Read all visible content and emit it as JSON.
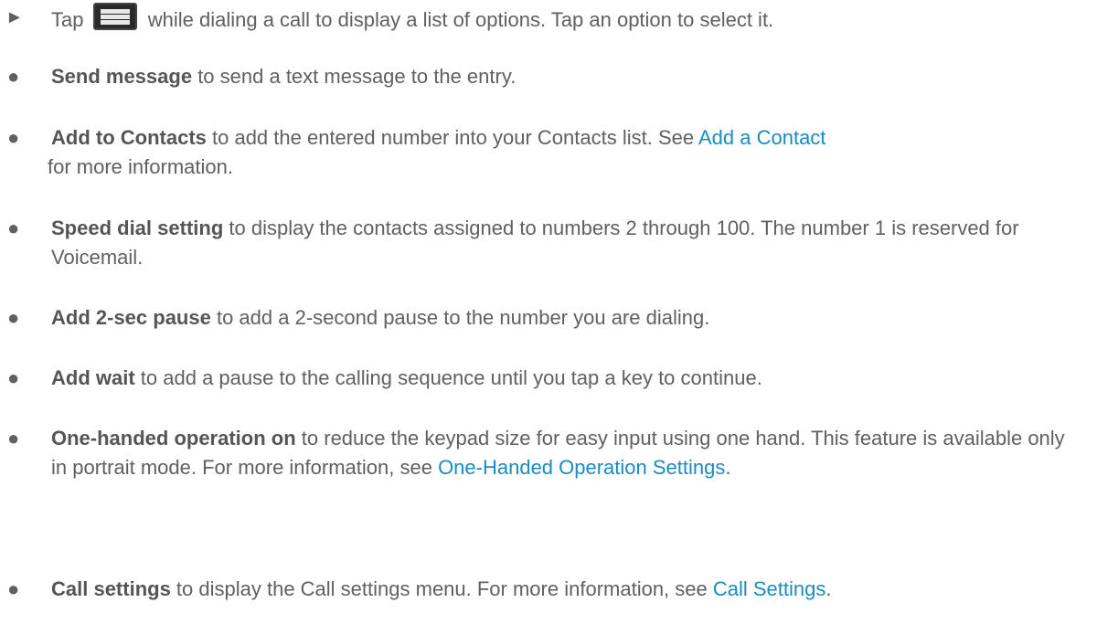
{
  "intro": {
    "bullet": "►",
    "before_icon": "Tap",
    "icon": "menu-icon",
    "after_icon": "while dialing a call to display a list of options. Tap an option to select it."
  },
  "options": [
    {
      "bullet": "●",
      "term": "Send message",
      "text": " to send a text message to the entry."
    },
    {
      "bullet": "●",
      "term": "Add to Contacts",
      "text": " to add the entered number into your Contacts list. See ",
      "link": "Add a Contact",
      "text_after": " for more information."
    },
    {
      "bullet": "●",
      "term": "Speed dial setting",
      "text": " to display the contacts assigned to numbers 2 through 100. The number 1 is reserved for Voicemail."
    },
    {
      "bullet": "●",
      "term": "Add 2-sec pause",
      "text": " to add a 2-second pause to the number you are dialing."
    },
    {
      "bullet": "●",
      "term": "Add wait",
      "text": " to add a pause to the calling sequence until you tap a key to continue."
    },
    {
      "bullet": "●",
      "term": "One-handed operation on",
      "text": " to reduce the keypad size for easy input using one hand. This feature is available only in portrait mode. For more information, see ",
      "link": "One-Handed Operation Settings",
      "text_after": "."
    },
    {
      "bullet": "●",
      "term": "Call settings",
      "text": " to display the Call settings menu. For more information, see ",
      "link": "Call Settings",
      "text_after": "."
    }
  ]
}
